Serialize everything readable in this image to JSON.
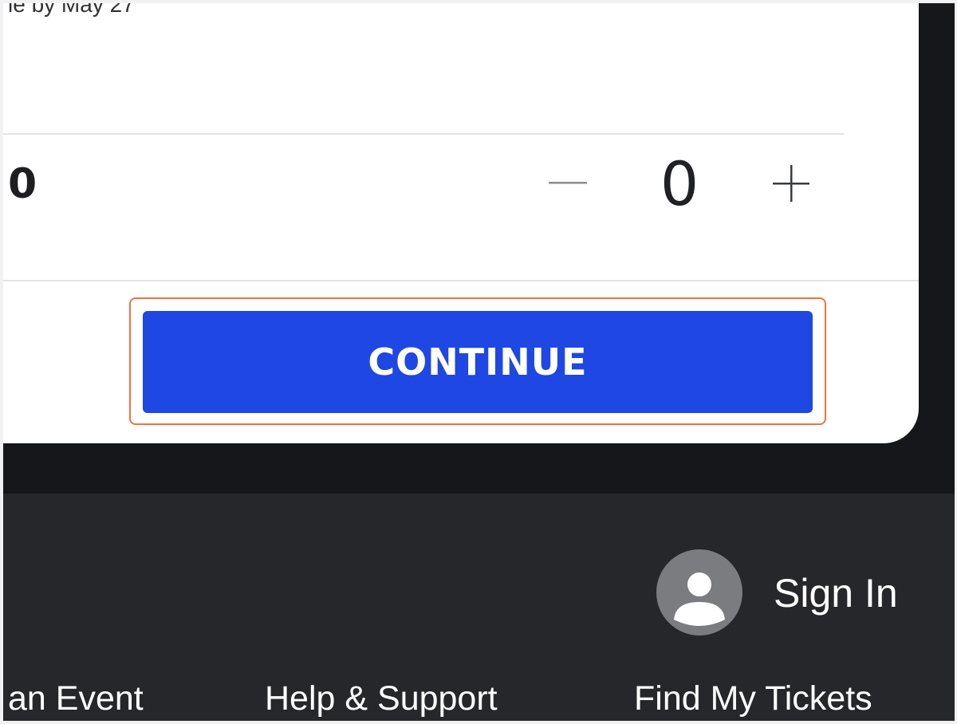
{
  "ticket_section": {
    "cut_off_text": "le by May 27",
    "price_fragment": "0",
    "quantity": {
      "minus_label": "−",
      "value": "0",
      "plus_label": "+"
    },
    "continue_label": "CONTINUE",
    "continue_color": "#1f47e3",
    "focus_ring_color": "#f07240"
  },
  "footer": {
    "avatar_icon": "user-icon",
    "sign_in_label": "Sign In",
    "links": [
      {
        "label": "an Event"
      },
      {
        "label": "Help & Support"
      },
      {
        "label": "Find My Tickets"
      }
    ]
  }
}
